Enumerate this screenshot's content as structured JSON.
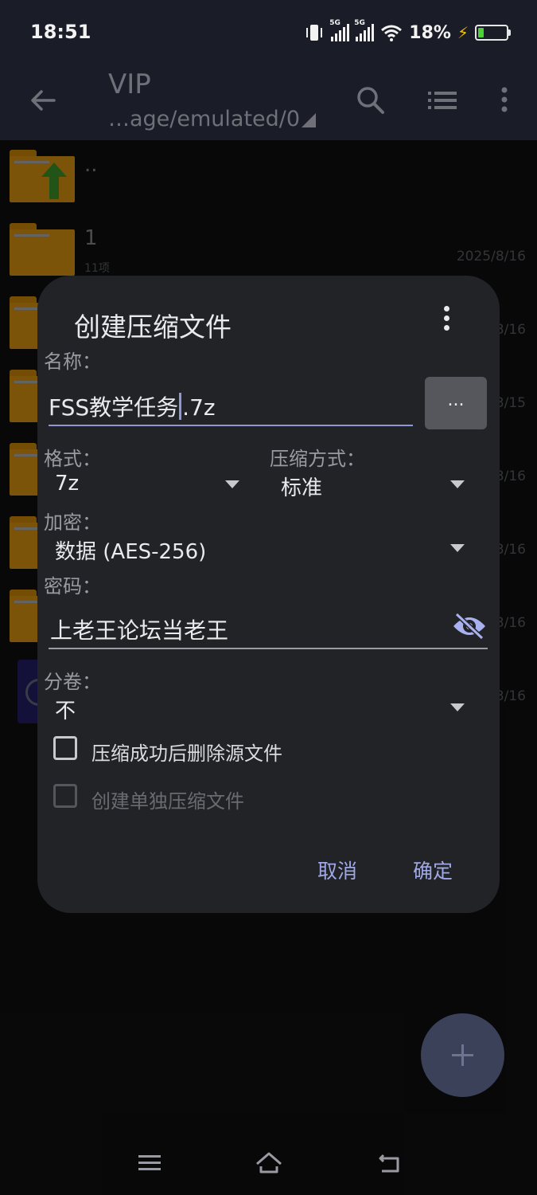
{
  "status_bar": {
    "time": "18:51",
    "battery_percent": "18%",
    "network_1": "5G",
    "network_2": "5G"
  },
  "app_bar": {
    "title": "VIP",
    "path": "…age/emulated/0",
    "icons": [
      "back-arrow-icon",
      "search-icon",
      "list-view-icon",
      "more-vert-icon"
    ]
  },
  "file_list": [
    {
      "name": "..",
      "sub": "",
      "date": ""
    },
    {
      "name": "1",
      "sub": "11项",
      "date": "2025/8/16"
    },
    {
      "name": "",
      "sub": "",
      "date": "3/16"
    },
    {
      "name": "",
      "sub": "",
      "date": "3/15"
    },
    {
      "name": "",
      "sub": "",
      "date": "3/16"
    },
    {
      "name": "",
      "sub": "",
      "date": "3/16"
    },
    {
      "name": "",
      "sub": "",
      "date": "3/16"
    },
    {
      "name": "",
      "sub": "",
      "date": "3/16"
    }
  ],
  "dialog": {
    "title": "创建压缩文件",
    "name_label": "名称：",
    "name_before_cursor": "FSS教学任务",
    "name_after_cursor": ".7z",
    "more_button": "...",
    "format_label": "格式：",
    "format_value": "7z",
    "method_label": "压缩方式：",
    "method_value": "标准",
    "encrypt_label": "加密：",
    "encrypt_value": "数据 (AES-256)",
    "password_label": "密码：",
    "password_value": "上老王论坛当老王",
    "split_label": "分卷：",
    "split_value": "不",
    "checkbox_delete": "压缩成功后删除源文件",
    "checkbox_separate": "创建单独压缩文件",
    "cancel": "取消",
    "confirm": "确定"
  },
  "colors": {
    "accent": "#9fa8e4",
    "dialog_bg": "#222327",
    "folder": "#e09a12",
    "app_bar_bg": "#1a1d27"
  }
}
